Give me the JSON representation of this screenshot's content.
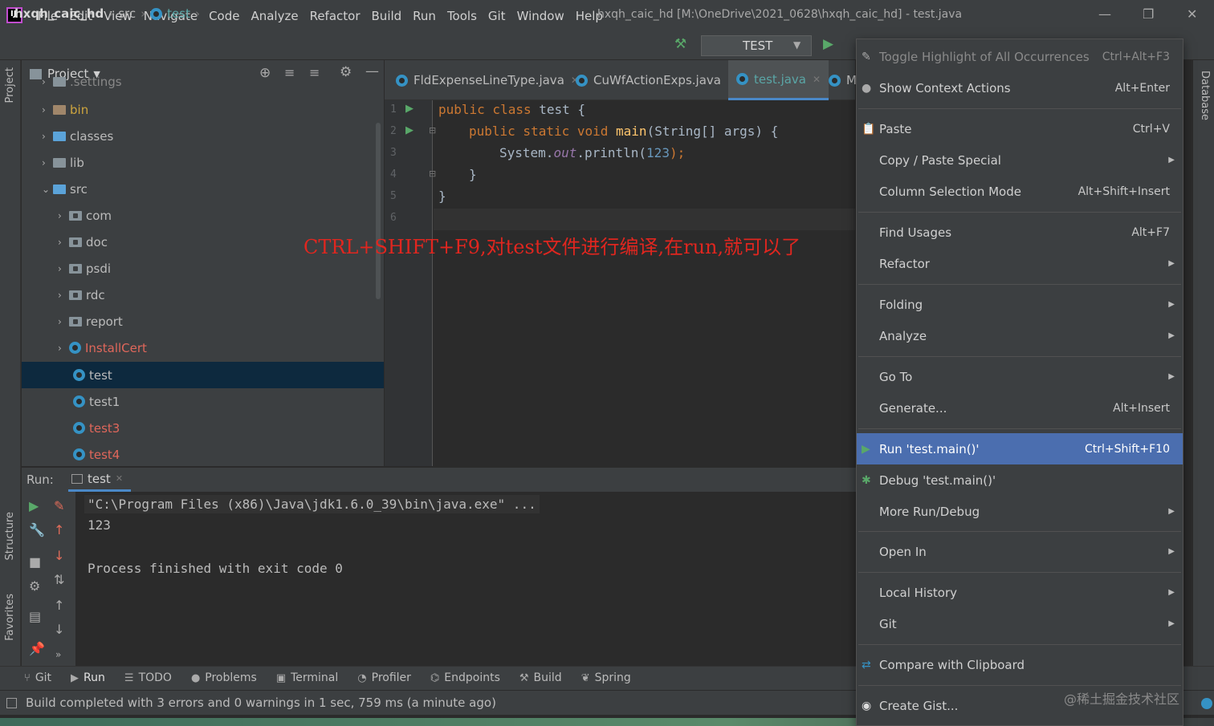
{
  "menubar": {
    "logo": "IJ",
    "items": [
      "File",
      "Edit",
      "View",
      "Navigate",
      "Code",
      "Analyze",
      "Refactor",
      "Build",
      "Run",
      "Tools",
      "Git",
      "Window",
      "Help"
    ],
    "window_title": "hxqh_caic_hd [M:\\OneDrive\\2021_0628\\hxqh_caic_hd] - test.java"
  },
  "navbar": {
    "crumbs": [
      "hxqh_caic_hd",
      "src",
      "test"
    ],
    "run_config": "TEST"
  },
  "left_strip": {
    "project": "Project",
    "structure": "Structure",
    "favorites": "Favorites"
  },
  "right_strip": {
    "database": "Database"
  },
  "project_panel": {
    "title": "Project",
    "cut_item": ".settings",
    "tree": [
      {
        "label": "bin",
        "color": "#cca43f"
      },
      {
        "label": "classes",
        "color": "#bbbbbb"
      },
      {
        "label": "lib",
        "color": "#bbbbbb"
      },
      {
        "label": "src",
        "color": "#bbbbbb"
      },
      {
        "label": "com",
        "color": "#bbbbbb"
      },
      {
        "label": "doc",
        "color": "#bbbbbb"
      },
      {
        "label": "psdi",
        "color": "#bbbbbb"
      },
      {
        "label": "rdc",
        "color": "#bbbbbb"
      },
      {
        "label": "report",
        "color": "#bbbbbb"
      },
      {
        "label": "InstallCert",
        "color": "#e0675b"
      },
      {
        "label": "test",
        "color": "#bbbbbb"
      },
      {
        "label": "test1",
        "color": "#bbbbbb"
      },
      {
        "label": "test3",
        "color": "#e0675b"
      },
      {
        "label": "test4",
        "color": "#e0675b"
      }
    ]
  },
  "editor": {
    "tabs": [
      {
        "label": "FldExpenseLineType.java",
        "active": false
      },
      {
        "label": "CuWfActionExps.java",
        "active": false
      },
      {
        "label": "test.java",
        "active": true
      },
      {
        "label": "M",
        "active": false
      }
    ],
    "line_numbers": [
      "1",
      "2",
      "3",
      "4",
      "5",
      "6"
    ],
    "code": {
      "l1_kw": "public class",
      "l1_rest": " test {",
      "l2_kw": "public static void",
      "l2_fn": "main",
      "l2_rest": "(String[] args) {",
      "l3_a": "System.",
      "l3_field": "out",
      "l3_b": ".println(",
      "l3_num": "123",
      "l3_c": ");",
      "l4": "}",
      "l5": "}"
    },
    "annotation": "CTRL+SHIFT+F9,对test文件进行编译,在run,就可以了"
  },
  "run_panel": {
    "label": "Run:",
    "tab": "test",
    "console": [
      "\"C:\\Program Files (x86)\\Java\\jdk1.6.0_39\\bin\\java.exe\" ...",
      "123",
      "Process finished with exit code 0"
    ]
  },
  "bottom_tools": [
    "Git",
    "Run",
    "TODO",
    "Problems",
    "Terminal",
    "Profiler",
    "Endpoints",
    "Build",
    "Spring"
  ],
  "status": {
    "text": "Build completed with 3 errors and 0 warnings in 1 sec, 759 ms (a minute ago)"
  },
  "context_menu": {
    "items": [
      {
        "label": "Toggle Highlight of All Occurrences",
        "shortcut": "Ctrl+Alt+F3"
      },
      {
        "label": "Show Context Actions",
        "shortcut": "Alt+Enter"
      },
      {
        "label": "Paste",
        "shortcut": "Ctrl+V"
      },
      {
        "label": "Copy / Paste Special",
        "shortcut": ""
      },
      {
        "label": "Column Selection Mode",
        "shortcut": "Alt+Shift+Insert"
      },
      {
        "label": "Find Usages",
        "shortcut": "Alt+F7"
      },
      {
        "label": "Refactor",
        "shortcut": ""
      },
      {
        "label": "Folding",
        "shortcut": ""
      },
      {
        "label": "Analyze",
        "shortcut": ""
      },
      {
        "label": "Go To",
        "shortcut": ""
      },
      {
        "label": "Generate...",
        "shortcut": "Alt+Insert"
      },
      {
        "label": "Run 'test.main()'",
        "shortcut": "Ctrl+Shift+F10"
      },
      {
        "label": "Debug 'test.main()'",
        "shortcut": ""
      },
      {
        "label": "More Run/Debug",
        "shortcut": ""
      },
      {
        "label": "Open In",
        "shortcut": ""
      },
      {
        "label": "Local History",
        "shortcut": ""
      },
      {
        "label": "Git",
        "shortcut": ""
      },
      {
        "label": "Compare with Clipboard",
        "shortcut": ""
      },
      {
        "label": "Create Gist...",
        "shortcut": ""
      }
    ]
  },
  "watermark": "@稀土掘金技术社区"
}
